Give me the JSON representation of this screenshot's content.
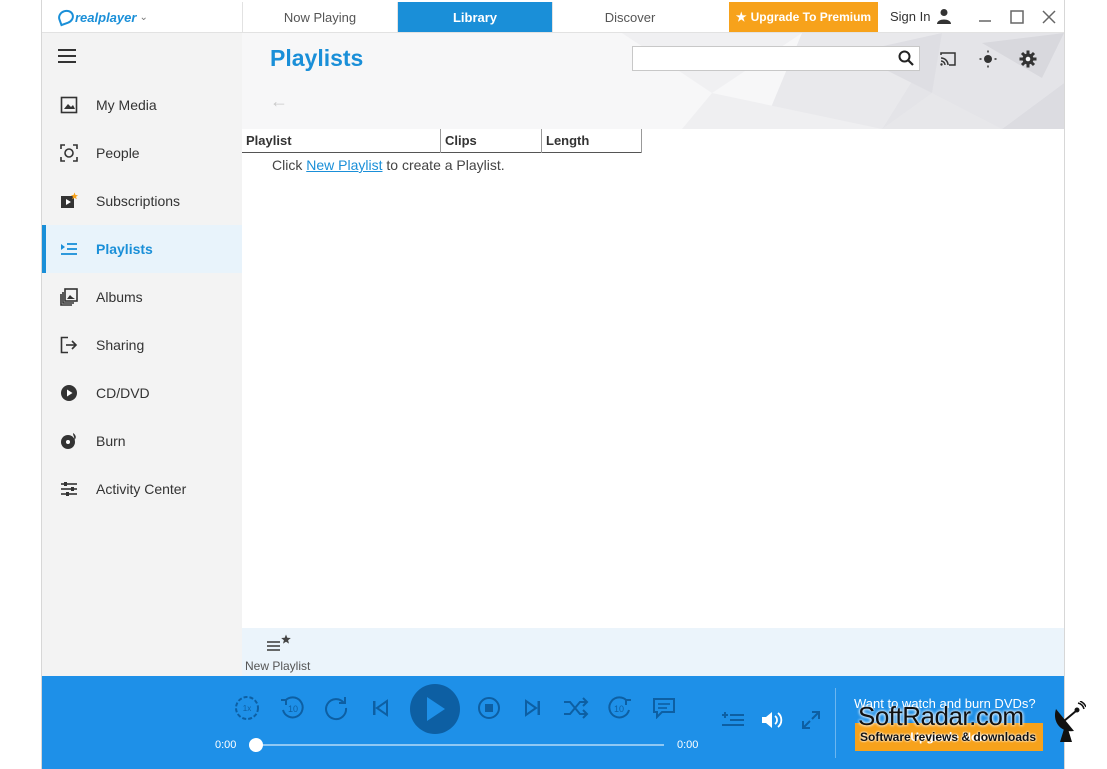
{
  "app": {
    "name": "realplayer"
  },
  "tabs": [
    {
      "label": "Now Playing",
      "active": false
    },
    {
      "label": "Library",
      "active": true
    },
    {
      "label": "Discover",
      "active": false
    }
  ],
  "header": {
    "upgrade_label": "Upgrade To Premium",
    "signin_label": "Sign In"
  },
  "sidebar": {
    "items": [
      {
        "label": "My Media",
        "icon": "image-icon"
      },
      {
        "label": "People",
        "icon": "face-frame-icon"
      },
      {
        "label": "Subscriptions",
        "icon": "subscriptions-icon"
      },
      {
        "label": "Playlists",
        "icon": "playlist-icon",
        "active": true
      },
      {
        "label": "Albums",
        "icon": "albums-icon"
      },
      {
        "label": "Sharing",
        "icon": "share-icon"
      },
      {
        "label": "CD/DVD",
        "icon": "disc-play-icon"
      },
      {
        "label": "Burn",
        "icon": "burn-icon"
      },
      {
        "label": "Activity Center",
        "icon": "sliders-icon"
      }
    ]
  },
  "main": {
    "title": "Playlists",
    "search_placeholder": "",
    "table": {
      "columns": [
        "Playlist",
        "Clips",
        "Length"
      ]
    },
    "empty": {
      "prefix": "Click ",
      "link": "New Playlist",
      "suffix": " to create a Playlist."
    },
    "footer": {
      "new_playlist_label": "New Playlist"
    }
  },
  "player": {
    "time_current": "0:00",
    "time_total": "0:00",
    "progress": 0,
    "skip_back_label": "10",
    "skip_forward_label": "10",
    "speed_label": "1x",
    "promo_text": "Want to watch and burn DVDs?",
    "promo_button": "Upgrade Now"
  },
  "watermark": {
    "title": "SoftRadar.com",
    "subtitle": "Software reviews & downloads"
  },
  "colors": {
    "accent": "#1a8fd8",
    "player_bg": "#1e90e8",
    "premium": "#f7a21b"
  }
}
